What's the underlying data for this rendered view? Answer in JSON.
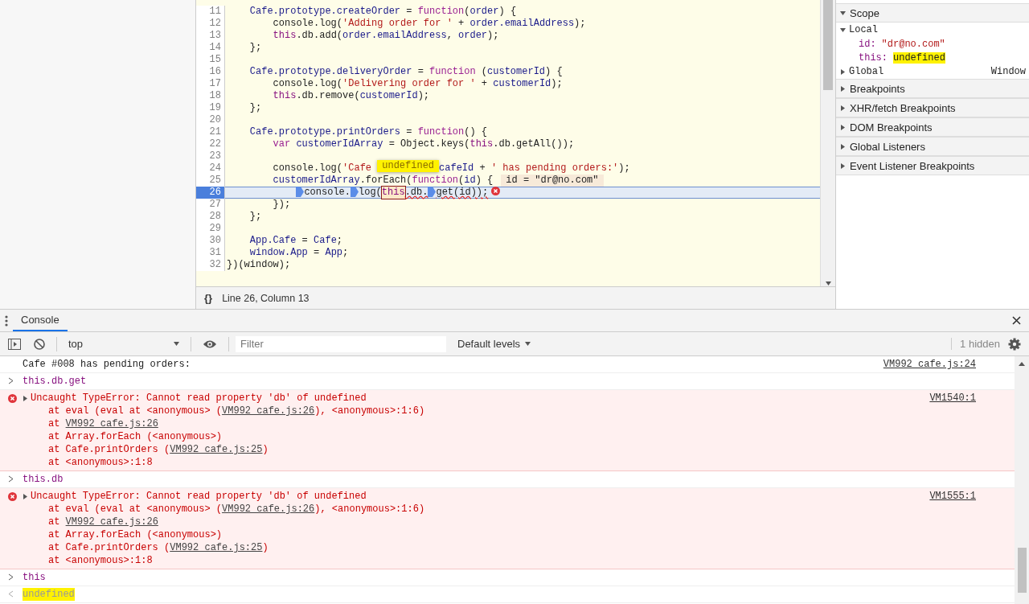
{
  "editor": {
    "lines": [
      {
        "n": "11",
        "current": false,
        "tokens": [
          {
            "kind": "id",
            "t": "    Cafe.prototype.createOrder"
          },
          {
            "kind": "plain",
            "t": " = "
          },
          {
            "kind": "kw",
            "t": "function"
          },
          {
            "kind": "plain",
            "t": "("
          },
          {
            "kind": "id",
            "t": "order"
          },
          {
            "kind": "plain",
            "t": ") {"
          }
        ]
      },
      {
        "n": "12",
        "current": false,
        "tokens": [
          {
            "kind": "plain",
            "t": "        console.log("
          },
          {
            "kind": "str",
            "t": "'Adding order for '"
          },
          {
            "kind": "plain",
            "t": " + "
          },
          {
            "kind": "id",
            "t": "order.emailAddress"
          },
          {
            "kind": "plain",
            "t": ");"
          }
        ]
      },
      {
        "n": "13",
        "current": false,
        "tokens": [
          {
            "kind": "this",
            "t": "        this"
          },
          {
            "kind": "plain",
            "t": ".db.add("
          },
          {
            "kind": "id",
            "t": "order.emailAddress"
          },
          {
            "kind": "plain",
            "t": ", "
          },
          {
            "kind": "id",
            "t": "order"
          },
          {
            "kind": "plain",
            "t": ");"
          }
        ]
      },
      {
        "n": "14",
        "current": false,
        "tokens": [
          {
            "kind": "plain",
            "t": "    };"
          }
        ]
      },
      {
        "n": "15",
        "current": false
      },
      {
        "n": "16",
        "current": false,
        "tokens": [
          {
            "kind": "id",
            "t": "    Cafe.prototype.deliveryOrder"
          },
          {
            "kind": "plain",
            "t": " = "
          },
          {
            "kind": "kw",
            "t": "function"
          },
          {
            "kind": "plain",
            "t": " ("
          },
          {
            "kind": "id",
            "t": "customerId"
          },
          {
            "kind": "plain",
            "t": ") {"
          }
        ]
      },
      {
        "n": "17",
        "current": false,
        "tokens": [
          {
            "kind": "plain",
            "t": "        console.log("
          },
          {
            "kind": "str",
            "t": "'Delivering order for '"
          },
          {
            "kind": "plain",
            "t": " + "
          },
          {
            "kind": "id",
            "t": "customerId"
          },
          {
            "kind": "plain",
            "t": ");"
          }
        ]
      },
      {
        "n": "18",
        "current": false,
        "tokens": [
          {
            "kind": "this",
            "t": "        this"
          },
          {
            "kind": "plain",
            "t": ".db.remove("
          },
          {
            "kind": "id",
            "t": "customerId"
          },
          {
            "kind": "plain",
            "t": ");"
          }
        ]
      },
      {
        "n": "19",
        "current": false,
        "tokens": [
          {
            "kind": "plain",
            "t": "    };"
          }
        ]
      },
      {
        "n": "20",
        "current": false
      },
      {
        "n": "21",
        "current": false,
        "tokens": [
          {
            "kind": "id",
            "t": "    Cafe.prototype.printOrders"
          },
          {
            "kind": "plain",
            "t": " = "
          },
          {
            "kind": "kw",
            "t": "function"
          },
          {
            "kind": "plain",
            "t": "() {"
          }
        ]
      },
      {
        "n": "22",
        "current": false,
        "tokens": [
          {
            "kind": "kw",
            "t": "        var"
          },
          {
            "kind": "id",
            "t": " customerIdArray"
          },
          {
            "kind": "plain",
            "t": " = Object.keys("
          },
          {
            "kind": "this",
            "t": "this"
          },
          {
            "kind": "plain",
            "t": ".db.getAll());"
          }
        ]
      },
      {
        "n": "23",
        "current": false
      },
      {
        "n": "24",
        "current": false,
        "tokens": [
          {
            "kind": "plain",
            "t": "        console.log("
          },
          {
            "kind": "str",
            "t": "'Cafe "
          },
          {
            "kind": "popover",
            "t": "undefined",
            "highlighted": true
          },
          {
            "kind": "id",
            "t": "cafeId"
          },
          {
            "kind": "plain",
            "t": " + "
          },
          {
            "kind": "str",
            "t": "' has pending orders:'"
          },
          {
            "kind": "plain",
            "t": ");"
          }
        ]
      },
      {
        "n": "25",
        "current": false,
        "tokens": [
          {
            "kind": "id",
            "t": "        customerIdArray"
          },
          {
            "kind": "plain",
            "t": ".forEach("
          },
          {
            "kind": "kw",
            "t": "function"
          },
          {
            "kind": "plain",
            "t": "("
          },
          {
            "kind": "id",
            "t": "id"
          },
          {
            "kind": "plain",
            "t": ") {"
          },
          {
            "kind": "inline-value",
            "t": "id = \"dr@no.com\""
          }
        ]
      },
      {
        "n": "26",
        "current": true,
        "tokens": [
          {
            "kind": "indented-marker"
          },
          {
            "kind": "plain",
            "t": "console."
          },
          {
            "kind": "marker"
          },
          {
            "kind": "plain",
            "t": "log("
          },
          {
            "kind": "this-boxed",
            "t": "this"
          },
          {
            "kind": "squiggle",
            "t": ".db."
          },
          {
            "kind": "marker"
          },
          {
            "kind": "squiggle",
            "t": "get(id));"
          },
          {
            "kind": "error-icon"
          }
        ]
      },
      {
        "n": "27",
        "current": false,
        "tokens": [
          {
            "kind": "plain",
            "t": "        });"
          }
        ]
      },
      {
        "n": "28",
        "current": false,
        "tokens": [
          {
            "kind": "plain",
            "t": "    };"
          }
        ]
      },
      {
        "n": "29",
        "current": false
      },
      {
        "n": "30",
        "current": false,
        "tokens": [
          {
            "kind": "id",
            "t": "    App.Cafe"
          },
          {
            "kind": "plain",
            "t": " = "
          },
          {
            "kind": "id",
            "t": "Cafe"
          },
          {
            "kind": "plain",
            "t": ";"
          }
        ]
      },
      {
        "n": "31",
        "current": false,
        "tokens": [
          {
            "kind": "id",
            "t": "    window.App"
          },
          {
            "kind": "plain",
            "t": " = "
          },
          {
            "kind": "id",
            "t": "App"
          },
          {
            "kind": "plain",
            "t": ";"
          }
        ]
      },
      {
        "n": "32",
        "current": false,
        "tokens": [
          {
            "kind": "plain",
            "t": "})(window);"
          }
        ]
      }
    ],
    "status": {
      "format_icon": "{}",
      "position": "Line 26, Column 13"
    }
  },
  "sidebar": {
    "sections": [
      {
        "title": "Scope",
        "expanded": true,
        "groups": [
          {
            "title": "Local",
            "expanded": true,
            "vars": [
              {
                "name": "id:",
                "value": "\"dr@no.com\"",
                "kind": "string",
                "highlighted": false
              },
              {
                "name": "this:",
                "value": "undefined",
                "kind": "plain",
                "highlighted": true
              }
            ]
          },
          {
            "title": "Global",
            "expanded": false,
            "value": "Window"
          }
        ]
      },
      {
        "title": "Breakpoints",
        "expanded": false
      },
      {
        "title": "XHR/fetch Breakpoints",
        "expanded": false
      },
      {
        "title": "DOM Breakpoints",
        "expanded": false
      },
      {
        "title": "Global Listeners",
        "expanded": false
      },
      {
        "title": "Event Listener Breakpoints",
        "expanded": false
      }
    ]
  },
  "console": {
    "tabs": [
      {
        "label": "Console",
        "selected": true
      }
    ],
    "toolbar": {
      "context": "top",
      "filter_placeholder": "Filter",
      "levels": "Default levels",
      "hidden": "1 hidden"
    },
    "messages": [
      {
        "kind": "log",
        "text": "Cafe #008 has pending orders:",
        "source": "VM992 cafe.js:24"
      },
      {
        "kind": "input",
        "text": "this.db.get",
        "highlighted": false
      },
      {
        "kind": "error",
        "text": "Uncaught TypeError: Cannot read property 'db' of undefined",
        "source": "VM1540:1",
        "stack": [
          [
            {
              "t": "at eval (eval at <anonymous> (",
              "kind": "text"
            },
            {
              "t": "VM992 cafe.js:26",
              "kind": "link"
            },
            {
              "t": "), <anonymous>:1:6)",
              "kind": "text"
            }
          ],
          [
            {
              "t": "at ",
              "kind": "text"
            },
            {
              "t": "VM992 cafe.js:26",
              "kind": "link"
            }
          ],
          [
            {
              "t": "at Array.forEach (<anonymous>)",
              "kind": "text"
            }
          ],
          [
            {
              "t": "at Cafe.printOrders (",
              "kind": "text"
            },
            {
              "t": "VM992 cafe.js:25",
              "kind": "link"
            },
            {
              "t": ")",
              "kind": "text"
            }
          ],
          [
            {
              "t": "at <anonymous>:1:8",
              "kind": "text"
            }
          ]
        ]
      },
      {
        "kind": "input",
        "text": "this.db",
        "highlighted": false
      },
      {
        "kind": "error",
        "text": "Uncaught TypeError: Cannot read property 'db' of undefined",
        "source": "VM1555:1",
        "stack": [
          [
            {
              "t": "at eval (eval at <anonymous> (",
              "kind": "text"
            },
            {
              "t": "VM992 cafe.js:26",
              "kind": "link"
            },
            {
              "t": "), <anonymous>:1:6)",
              "kind": "text"
            }
          ],
          [
            {
              "t": "at ",
              "kind": "text"
            },
            {
              "t": "VM992 cafe.js:26",
              "kind": "link"
            }
          ],
          [
            {
              "t": "at Array.forEach (<anonymous>)",
              "kind": "text"
            }
          ],
          [
            {
              "t": "at Cafe.printOrders (",
              "kind": "text"
            },
            {
              "t": "VM992 cafe.js:25",
              "kind": "link"
            },
            {
              "t": ")",
              "kind": "text"
            }
          ],
          [
            {
              "t": "at <anonymous>:1:8",
              "kind": "text"
            }
          ]
        ]
      },
      {
        "kind": "input",
        "text": "this",
        "highlighted": false
      },
      {
        "kind": "result",
        "text": "undefined",
        "highlighted": true
      }
    ]
  }
}
